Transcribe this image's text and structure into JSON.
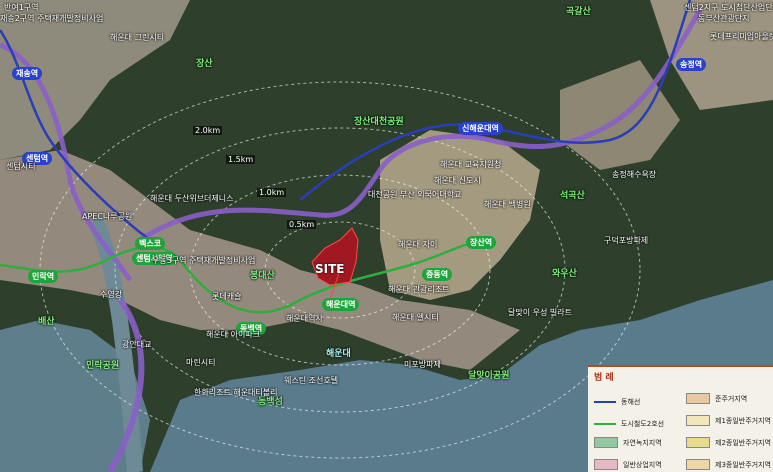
{
  "site": {
    "label": "SITE"
  },
  "rings": [
    "2.0km",
    "1.5km",
    "1.0km",
    "0.5km"
  ],
  "stations_line2": [
    "센텀시티역",
    "민락역",
    "벡스코",
    "동백역",
    "해운대역",
    "중동역",
    "장산역"
  ],
  "stations_donghae": [
    "센텀역",
    "재송역",
    "신해운대역",
    "송정역"
  ],
  "labels_green": [
    "장산",
    "장산대천공원",
    "봉대산",
    "석곡산",
    "와우산",
    "동백섬",
    "민락공원",
    "달맞이공원",
    "배산",
    "곡갈산"
  ],
  "labels_cyan": [
    "해운대"
  ],
  "labels_white": [
    "반여1구역",
    "센텀2지구 도시첨단산업단지",
    "재송2구역 주택재개발정비사업",
    "해운대 그린시티",
    "해운대 교육지원청",
    "대천공원 부산 외국어대학교",
    "해운대 백병원",
    "우동3구역 주택재개발정비사업",
    "해운대 두산위브더제니스",
    "롯데캐슬",
    "해운대 자이",
    "해운대 아이파크",
    "해운대 엘시티",
    "해운대 관광리조트",
    "웨스틴 조선호텔",
    "한화리조트 해운대티볼리",
    "마린시티",
    "미포방파제",
    "달맞이 우성 빌라트",
    "구덕포방파제",
    "롯데프리미엄아울렛 동부산점",
    "동부산관광단지",
    "송정해수욕장",
    "해운대 신도시",
    "해운대역사",
    "센텀시티",
    "APEC나루공원",
    "수영강",
    "광안대교"
  ],
  "legend": {
    "title": "범 례",
    "items": [
      {
        "label": "동해선",
        "type": "line",
        "color": "#2a3eb8"
      },
      {
        "label": "준주거지역",
        "type": "box",
        "color": "#e9c9a0"
      },
      {
        "label": "도시철도2호선",
        "type": "line",
        "color": "#2fae3c"
      },
      {
        "label": "제1종일반주거지역",
        "type": "box",
        "color": "#f3e6b8"
      },
      {
        "label": "자연녹지지역",
        "type": "box",
        "color": "#8fc9a0"
      },
      {
        "label": "제2종일반주거지역",
        "type": "box",
        "color": "#e6dc8c"
      },
      {
        "label": "일반상업지역",
        "type": "box",
        "color": "#e8b8c8"
      },
      {
        "label": "제3종일반주거지역",
        "type": "box",
        "color": "#eed7a6"
      }
    ]
  }
}
